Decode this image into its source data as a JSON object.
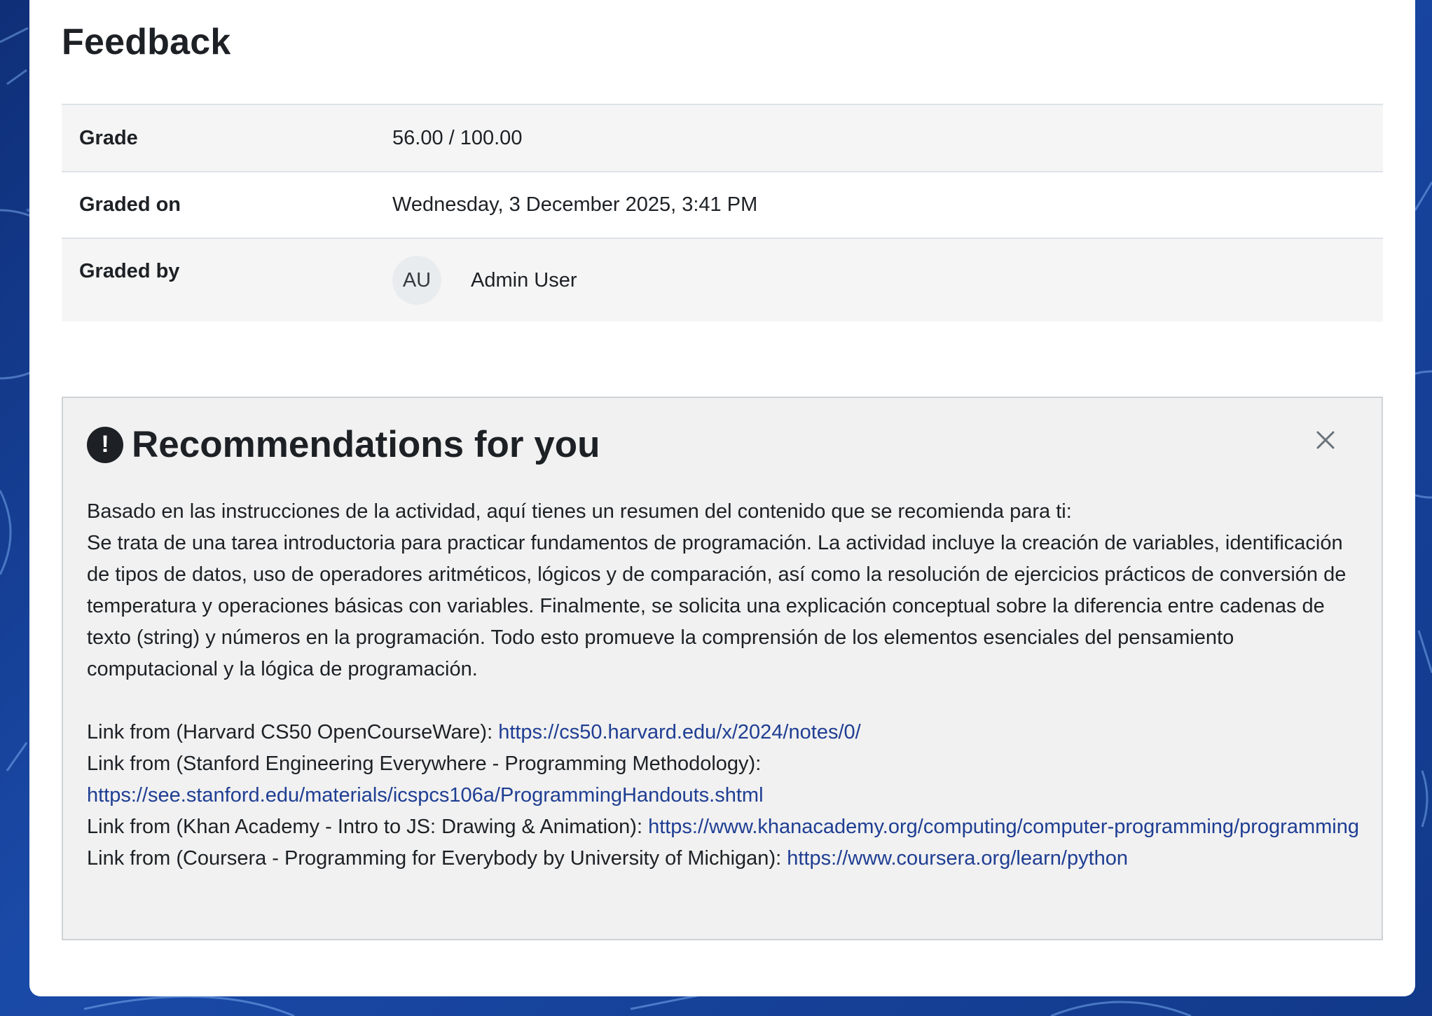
{
  "page": {
    "title": "Feedback"
  },
  "grade_table": {
    "rows": [
      {
        "label": "Grade",
        "value": "56.00 / 100.00"
      },
      {
        "label": "Graded on",
        "value": "Wednesday, 3 December 2025, 3:41 PM"
      },
      {
        "label": "Graded by",
        "avatar_initials": "AU",
        "value": "Admin User"
      }
    ]
  },
  "recommendations": {
    "icon": "exclamation-circle-icon",
    "title": "Recommendations for you",
    "close_icon": "close-icon",
    "intro": "Basado en las instrucciones de la actividad, aquí tienes un resumen del contenido que se recomienda para ti:",
    "summary": "Se trata de una tarea introductoria para practicar fundamentos de programación. La actividad incluye la creación de variables, identificación de tipos de datos, uso de operadores aritméticos, lógicos y de comparación, así como la resolución de ejercicios prácticos de conversión de temperatura y operaciones básicas con variables. Finalmente, se solicita una explicación conceptual sobre la diferencia entre cadenas de texto (string) y números en la programación. Todo esto promueve la comprensión de los elementos esenciales del pensamiento computacional y la lógica de programación.",
    "links": [
      {
        "prefix": "Link from (Harvard CS50 OpenCourseWare):",
        "url": "https://cs50.harvard.edu/x/2024/notes/0/"
      },
      {
        "prefix": "Link from (Stanford Engineering Everywhere - Programming Methodology):",
        "url": "https://see.stanford.edu/materials/icspcs106a/ProgrammingHandouts.shtml"
      },
      {
        "prefix": "Link from (Khan Academy - Intro to JS: Drawing & Animation):",
        "url": "https://www.khanacademy.org/computing/computer-programming/programming"
      },
      {
        "prefix": "Link from (Coursera - Programming for Everybody by University of Michigan):",
        "url": "https://www.coursera.org/learn/python"
      }
    ]
  },
  "colors": {
    "background": "#123a8c",
    "link": "#1f3e93",
    "panel": "#f1f1f1",
    "striped_row": "#f5f5f5",
    "text": "#1d2125"
  }
}
